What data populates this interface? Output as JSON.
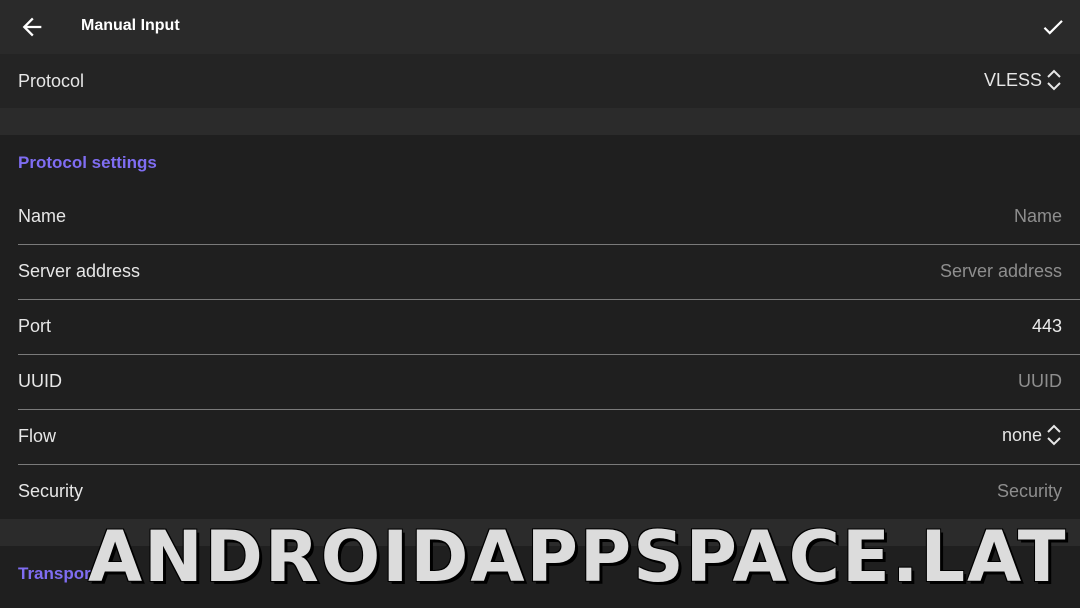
{
  "header": {
    "title": "Manual Input",
    "back_icon": "arrow-left-icon",
    "confirm_icon": "check-icon"
  },
  "protocol": {
    "label": "Protocol",
    "value": "VLESS"
  },
  "protocol_settings": {
    "title": "Protocol settings",
    "fields": [
      {
        "label": "Name",
        "value": "",
        "placeholder": "Name"
      },
      {
        "label": "Server address",
        "value": "",
        "placeholder": "Server address"
      },
      {
        "label": "Port",
        "value": "443",
        "placeholder": ""
      },
      {
        "label": "UUID",
        "value": "",
        "placeholder": "UUID"
      },
      {
        "label": "Flow",
        "value": "none",
        "placeholder": ""
      },
      {
        "label": "Security",
        "value": "",
        "placeholder": "Security"
      }
    ]
  },
  "transport": {
    "title": "Transpor"
  },
  "watermark": "ANDROIDAPPSPACE.LAT",
  "colors": {
    "accent": "#7f6df2",
    "background": "#1e1e1e",
    "topbar": "#2a2a2a"
  }
}
